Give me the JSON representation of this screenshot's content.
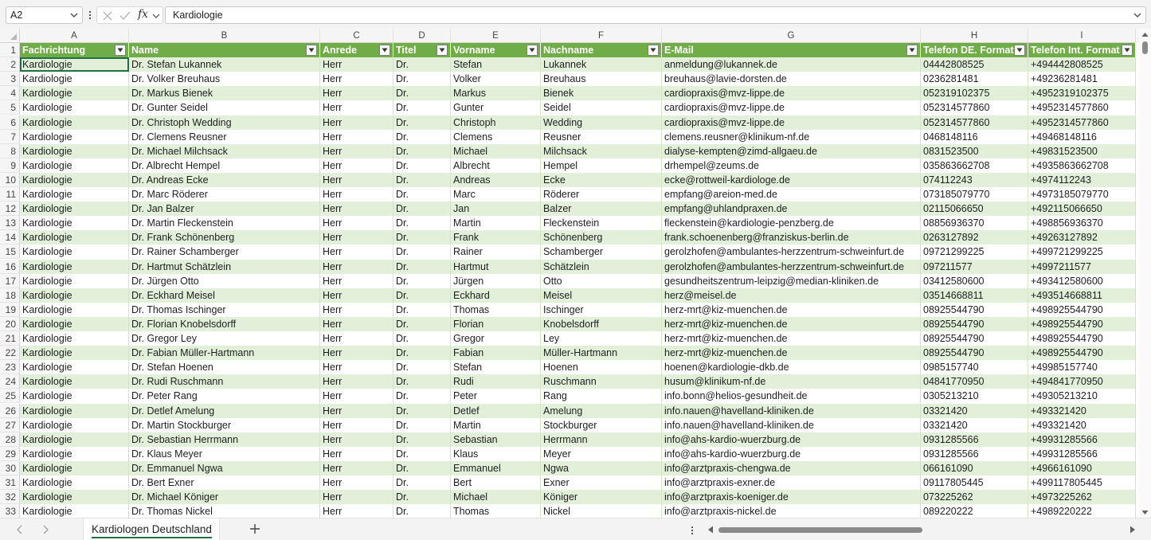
{
  "formula_bar": {
    "name_box": "A2",
    "cancel_icon": "close-icon",
    "enter_icon": "check-icon",
    "function_label": "fx",
    "content": "Kardiologie"
  },
  "columns": [
    "A",
    "B",
    "C",
    "D",
    "E",
    "F",
    "G",
    "H",
    "I"
  ],
  "header": {
    "row_number": "1",
    "cells": [
      "Fachrichtung",
      "Name",
      "Anrede",
      "Titel",
      "Vorname",
      "Nachname",
      "E-Mail",
      "Telefon DE. Format",
      "Telefon Int. Format"
    ]
  },
  "rows": [
    {
      "n": "2",
      "cells": [
        "Kardiologie",
        "Dr. Stefan Lukannek",
        "Herr",
        "Dr.",
        "Stefan",
        "Lukannek",
        "anmeldung@lukannek.de",
        "04442808525",
        "+494442808525"
      ]
    },
    {
      "n": "3",
      "cells": [
        "Kardiologie",
        "Dr. Volker Breuhaus",
        "Herr",
        "Dr.",
        "Volker",
        "Breuhaus",
        "breuhaus@lavie-dorsten.de",
        "0236281481",
        "+49236281481"
      ]
    },
    {
      "n": "4",
      "cells": [
        "Kardiologie",
        "Dr. Markus Bienek",
        "Herr",
        "Dr.",
        "Markus",
        "Bienek",
        "cardiopraxis@mvz-lippe.de",
        "052319102375",
        "+4952319102375"
      ]
    },
    {
      "n": "5",
      "cells": [
        "Kardiologie",
        "Dr. Gunter Seidel",
        "Herr",
        "Dr.",
        "Gunter",
        "Seidel",
        "cardiopraxis@mvz-lippe.de",
        "052314577860",
        "+4952314577860"
      ]
    },
    {
      "n": "6",
      "cells": [
        "Kardiologie",
        "Dr. Christoph Wedding",
        "Herr",
        "Dr.",
        "Christoph",
        "Wedding",
        "cardiopraxis@mvz-lippe.de",
        "052314577860",
        "+4952314577860"
      ]
    },
    {
      "n": "7",
      "cells": [
        "Kardiologie",
        "Dr. Clemens Reusner",
        "Herr",
        "Dr.",
        "Clemens",
        "Reusner",
        "clemens.reusner@klinikum-nf.de",
        "0468148116",
        "+49468148116"
      ]
    },
    {
      "n": "8",
      "cells": [
        "Kardiologie",
        "Dr. Michael Milchsack",
        "Herr",
        "Dr.",
        "Michael",
        "Milchsack",
        "dialyse-kempten@zimd-allgaeu.de",
        "0831523500",
        "+49831523500"
      ]
    },
    {
      "n": "9",
      "cells": [
        "Kardiologie",
        "Dr. Albrecht Hempel",
        "Herr",
        "Dr.",
        "Albrecht",
        "Hempel",
        "drhempel@zeums.de",
        "035863662708",
        "+4935863662708"
      ]
    },
    {
      "n": "10",
      "cells": [
        "Kardiologie",
        "Dr. Andreas Ecke",
        "Herr",
        "Dr.",
        "Andreas",
        "Ecke",
        "ecke@rottweil-kardiologe.de",
        "074112243",
        "+4974112243"
      ]
    },
    {
      "n": "11",
      "cells": [
        "Kardiologie",
        "Dr. Marc Röderer",
        "Herr",
        "Dr.",
        "Marc",
        "Röderer",
        "empfang@areion-med.de",
        "073185079770",
        "+4973185079770"
      ]
    },
    {
      "n": "12",
      "cells": [
        "Kardiologie",
        "Dr. Jan Balzer",
        "Herr",
        "Dr.",
        "Jan",
        "Balzer",
        "empfang@uhlandpraxen.de",
        "02115066650",
        "+492115066650"
      ]
    },
    {
      "n": "13",
      "cells": [
        "Kardiologie",
        "Dr. Martin Fleckenstein",
        "Herr",
        "Dr.",
        "Martin",
        "Fleckenstein",
        "fleckenstein@kardiologie-penzberg.de",
        "08856936370",
        "+498856936370"
      ]
    },
    {
      "n": "14",
      "cells": [
        "Kardiologie",
        "Dr. Frank Schönenberg",
        "Herr",
        "Dr.",
        "Frank",
        "Schönenberg",
        "frank.schoenenberg@franziskus-berlin.de",
        "0263127892",
        "+49263127892"
      ]
    },
    {
      "n": "15",
      "cells": [
        "Kardiologie",
        "Dr. Rainer Schamberger",
        "Herr",
        "Dr.",
        "Rainer",
        "Schamberger",
        "gerolzhofen@ambulantes-herzzentrum-schweinfurt.de",
        "09721299225",
        "+499721299225"
      ]
    },
    {
      "n": "16",
      "cells": [
        "Kardiologie",
        "Dr. Hartmut Schätzlein",
        "Herr",
        "Dr.",
        "Hartmut",
        "Schätzlein",
        "gerolzhofen@ambulantes-herzzentrum-schweinfurt.de",
        "097211577",
        "+4997211577"
      ]
    },
    {
      "n": "17",
      "cells": [
        "Kardiologie",
        "Dr. Jürgen Otto",
        "Herr",
        "Dr.",
        "Jürgen",
        "Otto",
        "gesundheitszentrum-leipzig@median-kliniken.de",
        "03412580600",
        "+493412580600"
      ]
    },
    {
      "n": "18",
      "cells": [
        "Kardiologie",
        "Dr. Eckhard Meisel",
        "Herr",
        "Dr.",
        "Eckhard",
        "Meisel",
        "herz@meisel.de",
        "03514668811",
        "+493514668811"
      ]
    },
    {
      "n": "19",
      "cells": [
        "Kardiologie",
        "Dr. Thomas Ischinger",
        "Herr",
        "Dr.",
        "Thomas",
        "Ischinger",
        "herz-mrt@kiz-muenchen.de",
        "08925544790",
        "+498925544790"
      ]
    },
    {
      "n": "20",
      "cells": [
        "Kardiologie",
        "Dr. Florian Knobelsdorff",
        "Herr",
        "Dr.",
        "Florian",
        "Knobelsdorff",
        "herz-mrt@kiz-muenchen.de",
        "08925544790",
        "+498925544790"
      ]
    },
    {
      "n": "21",
      "cells": [
        "Kardiologie",
        "Dr. Gregor Ley",
        "Herr",
        "Dr.",
        "Gregor",
        "Ley",
        "herz-mrt@kiz-muenchen.de",
        "08925544790",
        "+498925544790"
      ]
    },
    {
      "n": "22",
      "cells": [
        "Kardiologie",
        "Dr. Fabian Müller-Hartmann",
        "Herr",
        "Dr.",
        "Fabian",
        "Müller-Hartmann",
        "herz-mrt@kiz-muenchen.de",
        "08925544790",
        "+498925544790"
      ]
    },
    {
      "n": "23",
      "cells": [
        "Kardiologie",
        "Dr. Stefan Hoenen",
        "Herr",
        "Dr.",
        "Stefan",
        "Hoenen",
        "hoenen@kardiologie-dkb.de",
        "0985157740",
        "+49985157740"
      ]
    },
    {
      "n": "24",
      "cells": [
        "Kardiologie",
        "Dr. Rudi Ruschmann",
        "Herr",
        "Dr.",
        "Rudi",
        "Ruschmann",
        "husum@klinikum-nf.de",
        "04841770950",
        "+494841770950"
      ]
    },
    {
      "n": "25",
      "cells": [
        "Kardiologie",
        "Dr. Peter Rang",
        "Herr",
        "Dr.",
        "Peter",
        "Rang",
        "info.bonn@helios-gesundheit.de",
        "0305213210",
        "+49305213210"
      ]
    },
    {
      "n": "26",
      "cells": [
        "Kardiologie",
        "Dr. Detlef Amelung",
        "Herr",
        "Dr.",
        "Detlef",
        "Amelung",
        "info.nauen@havelland-kliniken.de",
        "03321420",
        "+493321420"
      ]
    },
    {
      "n": "27",
      "cells": [
        "Kardiologie",
        "Dr. Martin Stockburger",
        "Herr",
        "Dr.",
        "Martin",
        "Stockburger",
        "info.nauen@havelland-kliniken.de",
        "03321420",
        "+493321420"
      ]
    },
    {
      "n": "28",
      "cells": [
        "Kardiologie",
        "Dr. Sebastian Herrmann",
        "Herr",
        "Dr.",
        "Sebastian",
        "Herrmann",
        "info@ahs-kardio-wuerzburg.de",
        "0931285566",
        "+49931285566"
      ]
    },
    {
      "n": "29",
      "cells": [
        "Kardiologie",
        "Dr. Klaus Meyer",
        "Herr",
        "Dr.",
        "Klaus",
        "Meyer",
        "info@ahs-kardio-wuerzburg.de",
        "0931285566",
        "+49931285566"
      ]
    },
    {
      "n": "30",
      "cells": [
        "Kardiologie",
        "Dr. Emmanuel Ngwa",
        "Herr",
        "Dr.",
        "Emmanuel",
        "Ngwa",
        "info@arztpraxis-chengwa.de",
        "066161090",
        "+4966161090"
      ]
    },
    {
      "n": "31",
      "cells": [
        "Kardiologie",
        "Dr. Bert Exner",
        "Herr",
        "Dr.",
        "Bert",
        "Exner",
        "info@arztpraxis-exner.de",
        "09117805445",
        "+499117805445"
      ]
    },
    {
      "n": "32",
      "cells": [
        "Kardiologie",
        "Dr. Michael Königer",
        "Herr",
        "Dr.",
        "Michael",
        "Königer",
        "info@arztpraxis-koeniger.de",
        "073225262",
        "+4973225262"
      ]
    },
    {
      "n": "33",
      "cells": [
        "Kardiologie",
        "Dr. Thomas Nickel",
        "Herr",
        "Dr.",
        "Thomas",
        "Nickel",
        "info@arztpraxis-nickel.de",
        "089220222",
        "+4989220222"
      ]
    }
  ],
  "sheet_tabs": [
    "Kardiologen Deutschland"
  ],
  "colors": {
    "table_header": "#70ad47",
    "band": "#e2efd9",
    "selection": "#1e7145"
  }
}
